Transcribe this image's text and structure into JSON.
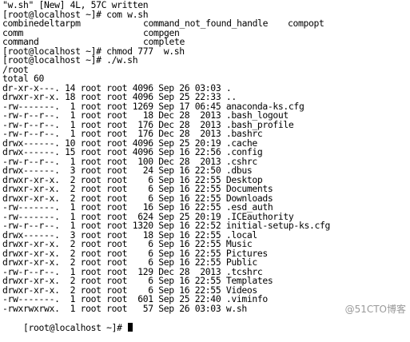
{
  "terminal": {
    "status_line": "\"w.sh\" [New] 4L, 57C written",
    "prompt1": "[root@localhost ~]# com w.sh",
    "completions": [
      [
        "combinedeltarpm",
        "command_not_found_handle",
        "compopt"
      ],
      [
        "comm",
        "compgen",
        ""
      ],
      [
        "command",
        "complete",
        ""
      ]
    ],
    "prompt2": "[root@localhost ~]# chmod 777  w.sh",
    "prompt3": "[root@localhost ~]# ./w.sh",
    "output_pwd": "/root",
    "output_total": "total 60",
    "listing": [
      "dr-xr-x---. 14 root root 4096 Sep 26 03:03 .",
      "drwxr-xr-x. 18 root root 4096 Sep 25 22:33 ..",
      "-rw-------.  1 root root 1269 Sep 17 06:45 anaconda-ks.cfg",
      "-rw-r--r--.  1 root root   18 Dec 28  2013 .bash_logout",
      "-rw-r--r--.  1 root root  176 Dec 28  2013 .bash_profile",
      "-rw-r--r--.  1 root root  176 Dec 28  2013 .bashrc",
      "drwx------. 10 root root 4096 Sep 25 20:19 .cache",
      "drwx------. 15 root root 4096 Sep 16 22:56 .config",
      "-rw-r--r--.  1 root root  100 Dec 28  2013 .cshrc",
      "drwx------.  3 root root   24 Sep 16 22:50 .dbus",
      "drwxr-xr-x.  2 root root    6 Sep 16 22:55 Desktop",
      "drwxr-xr-x.  2 root root    6 Sep 16 22:55 Documents",
      "drwxr-xr-x.  2 root root    6 Sep 16 22:55 Downloads",
      "-rw-------.  1 root root   16 Sep 16 22:55 .esd_auth",
      "-rw-------.  1 root root  624 Sep 25 20:19 .ICEauthority",
      "-rw-r--r--.  1 root root 1320 Sep 16 22:52 initial-setup-ks.cfg",
      "drwx------.  3 root root   18 Sep 16 22:55 .local",
      "drwxr-xr-x.  2 root root    6 Sep 16 22:55 Music",
      "drwxr-xr-x.  2 root root    6 Sep 16 22:55 Pictures",
      "drwxr-xr-x.  2 root root    6 Sep 16 22:55 Public",
      "-rw-r--r--.  1 root root  129 Dec 28  2013 .tcshrc",
      "drwxr-xr-x.  2 root root    6 Sep 16 22:55 Templates",
      "drwxr-xr-x.  2 root root    6 Sep 16 22:55 Videos",
      "-rw-------.  1 root root  601 Sep 25 22:40 .viminfo",
      "-rwxrwxrwx.  1 root root   57 Sep 26 03:03 w.sh"
    ],
    "final_prompt": "[root@localhost ~]# "
  },
  "watermark": "@51CTO博客"
}
